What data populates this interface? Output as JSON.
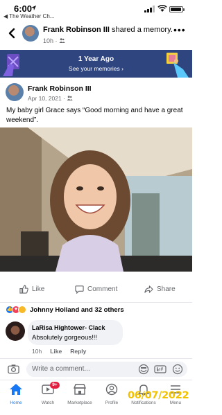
{
  "status_bar": {
    "time": "6:00",
    "back_app": "◀ The Weather Ch..."
  },
  "header": {
    "author": "Frank Robinson III",
    "action": " shared a memory.",
    "time": "10h"
  },
  "banner": {
    "title": "1 Year Ago",
    "link": "See your memories"
  },
  "post": {
    "author": "Frank Robinson III",
    "date": "Apr 10, 2021",
    "text": "My baby girl Grace says “Good morning and have a great weekend”."
  },
  "actions": {
    "like": "Like",
    "comment": "Comment",
    "share": "Share"
  },
  "reactions": {
    "summary": "Johnny Holland and 32 others"
  },
  "comment": {
    "author": "LaRisa Hightower- Clack",
    "text": "Absolutely gorgeous!!!",
    "time": "10h",
    "like": "Like",
    "reply": "Reply"
  },
  "composer": {
    "placeholder": "Write a comment..."
  },
  "nav": {
    "home": "Home",
    "watch": "Watch",
    "watch_badge": "9+",
    "marketplace": "Marketplace",
    "profile": "Profile",
    "notifications": "Notifications",
    "menu": "Menu"
  },
  "date_stamp": "06/07/2022",
  "colors": {
    "brand_blue": "#1877f2",
    "banner_bg": "#2f4580",
    "badge_red": "#e41e3f",
    "stamp_yellow": "#f2c200"
  }
}
